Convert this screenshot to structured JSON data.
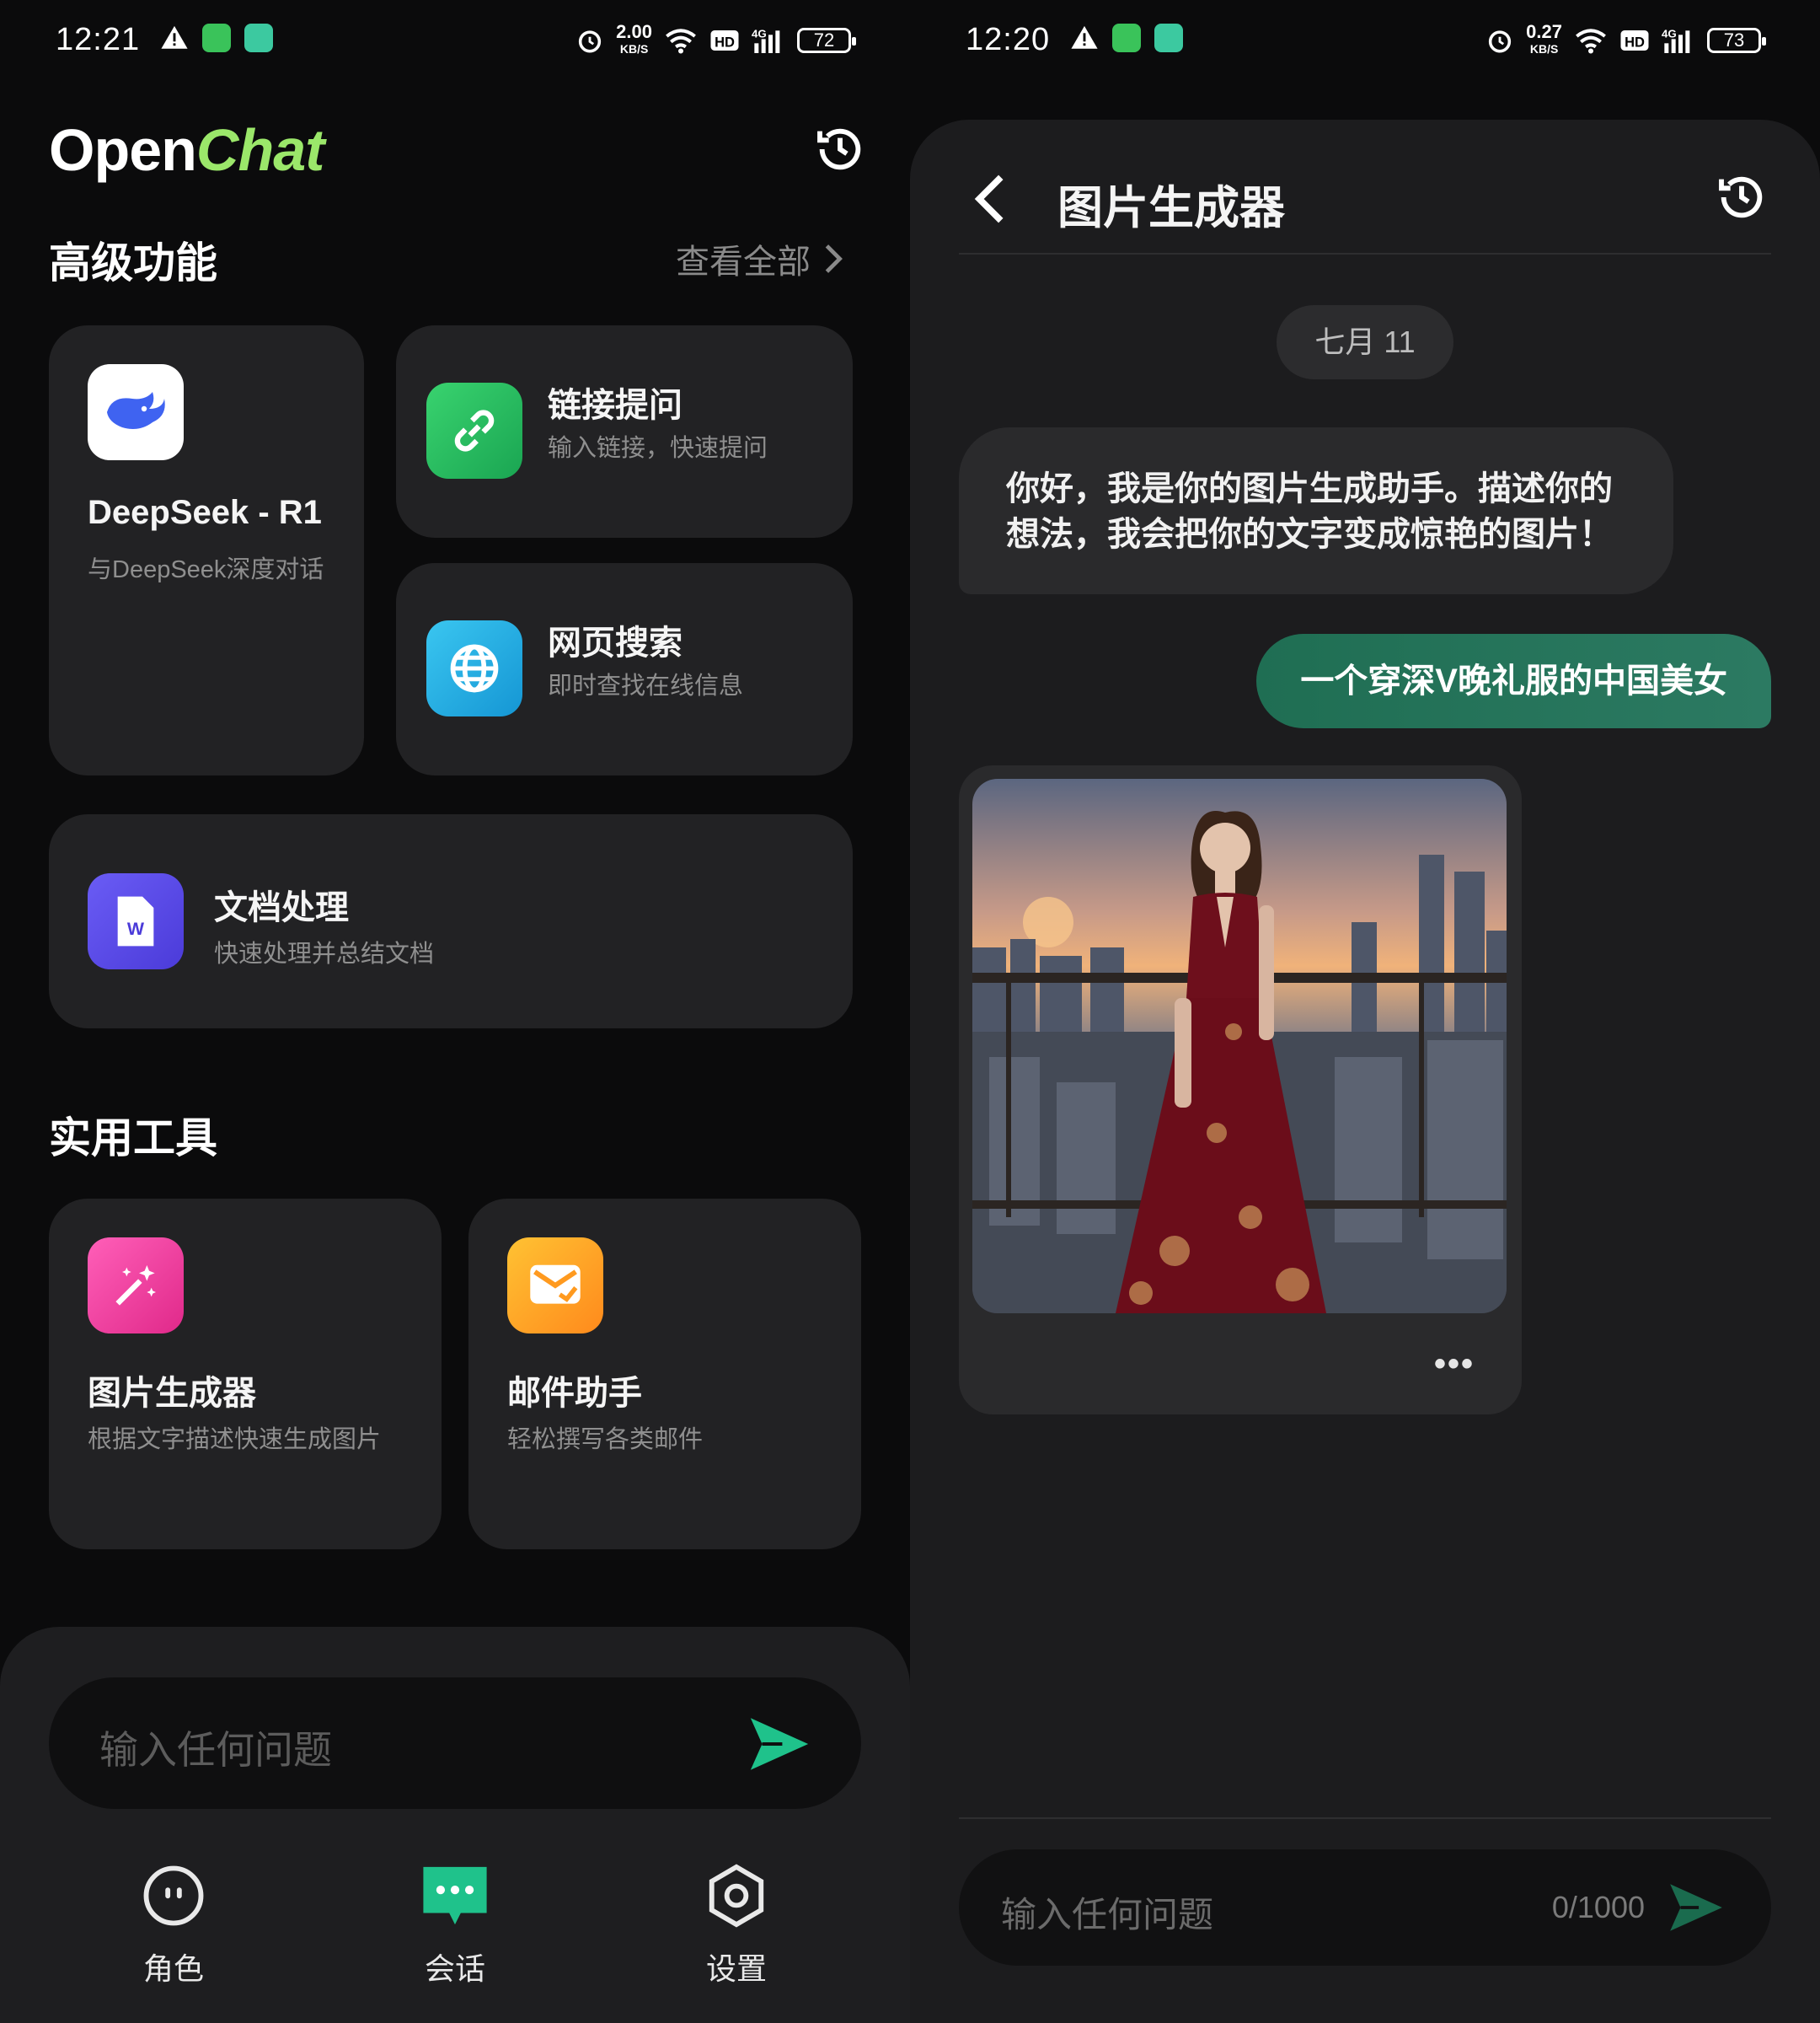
{
  "left": {
    "status": {
      "time": "12:21",
      "speed": "2.00",
      "speed_unit": "KB/S",
      "battery": "72"
    },
    "app": {
      "logo_part1": "Open",
      "logo_part2": "Chat"
    },
    "advanced": {
      "title": "高级功能",
      "view_all": "查看全部",
      "deepseek": {
        "title": "DeepSeek - R1",
        "sub": "与DeepSeek深度对话"
      },
      "link_qa": {
        "title": "链接提问",
        "sub": "输入链接，快速提问"
      },
      "web_search": {
        "title": "网页搜索",
        "sub": "即时查找在线信息"
      },
      "doc": {
        "title": "文档处理",
        "sub": "快速处理并总结文档"
      }
    },
    "tools": {
      "title": "实用工具",
      "image_gen": {
        "title": "图片生成器",
        "sub": "根据文字描述快速生成图片"
      },
      "mail": {
        "title": "邮件助手",
        "sub": "轻松撰写各类邮件"
      }
    },
    "input": {
      "placeholder": "输入任何问题"
    },
    "nav": {
      "roles": "角色",
      "chat": "会话",
      "settings": "设置"
    }
  },
  "right": {
    "status": {
      "time": "12:20",
      "speed": "0.27",
      "speed_unit": "KB/S",
      "battery": "73"
    },
    "title": "图片生成器",
    "date": "七月 11",
    "bot_message": "你好，我是你的图片生成助手。描述你的想法，我会把你的文字变成惊艳的图片！",
    "user_message": "一个穿深V晚礼服的中国美女",
    "input": {
      "placeholder": "输入任何问题",
      "counter": "0/1000"
    }
  },
  "colors": {
    "accent_green": "#1fc28b",
    "logo_green": "#9be76a",
    "user_bubble": "#1f6e53"
  }
}
